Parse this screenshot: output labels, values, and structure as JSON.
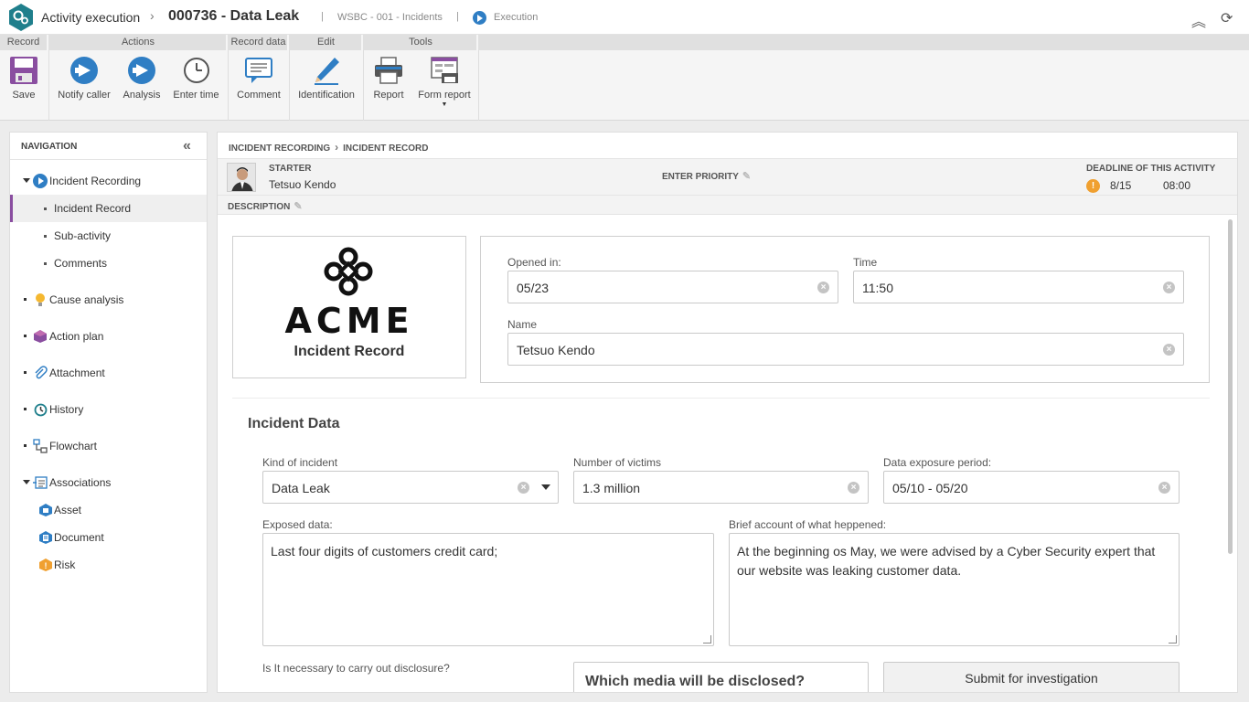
{
  "header": {
    "app_title": "Activity execution",
    "record_title": "000736 - Data Leak",
    "process": "WSBC - 001 - Incidents",
    "status": "Execution"
  },
  "ribbon": {
    "groups": [
      "Record",
      "Actions",
      "Record data",
      "Edit",
      "Tools"
    ],
    "buttons": {
      "save": "Save",
      "notify_caller": "Notify caller",
      "analysis": "Analysis",
      "enter_time": "Enter time",
      "comment": "Comment",
      "identification": "Identification",
      "report": "Report",
      "form_report": "Form report"
    }
  },
  "nav": {
    "title": "NAVIGATION",
    "items": {
      "incident_recording": "Incident Recording",
      "incident_record": "Incident Record",
      "sub_activity": "Sub-activity",
      "comments": "Comments",
      "cause_analysis": "Cause analysis",
      "action_plan": "Action plan",
      "attachment": "Attachment",
      "history": "History",
      "flowchart": "Flowchart",
      "associations": "Associations",
      "asset": "Asset",
      "document": "Document",
      "risk": "Risk"
    }
  },
  "main": {
    "breadcrumb": [
      "INCIDENT RECORDING",
      "INCIDENT RECORD"
    ],
    "starter_label": "STARTER",
    "starter_name": "Tetsuo Kendo",
    "priority_label": "ENTER PRIORITY",
    "deadline_label": "DEADLINE OF THIS ACTIVITY",
    "deadline_date": "8/15",
    "deadline_time": "08:00",
    "description_label": "DESCRIPTION"
  },
  "form": {
    "logo_text": "ACME",
    "logo_caption": "Incident Record",
    "opened_label": "Opened in:",
    "opened_value": "05/23",
    "time_label": "Time",
    "time_value": "11:50",
    "name_label": "Name",
    "name_value": "Tetsuo Kendo",
    "section_title": "Incident Data",
    "kind_label": "Kind of incident",
    "kind_value": "Data Leak",
    "victims_label": "Number of victims",
    "victims_value": "1.3 million",
    "exposure_label": "Data exposure period:",
    "exposure_value": "05/10 - 05/20",
    "exposed_label": "Exposed data:",
    "exposed_value": "Last four digits of customers credit card;",
    "account_label": "Brief account of what heppened:",
    "account_value": "At the beginning os May, we were advised by a Cyber Security expert that our website was leaking customer data.",
    "disclosure_label": "Is It necessary to carry out disclosure?",
    "media_label": "Which media will be disclosed?",
    "submit_label": "Submit for investigation"
  },
  "colors": {
    "accent_blue": "#2f7ec4",
    "nav_active": "#8a4ea0",
    "logo_teal": "#1f7f8c",
    "warning": "#f0a030"
  }
}
